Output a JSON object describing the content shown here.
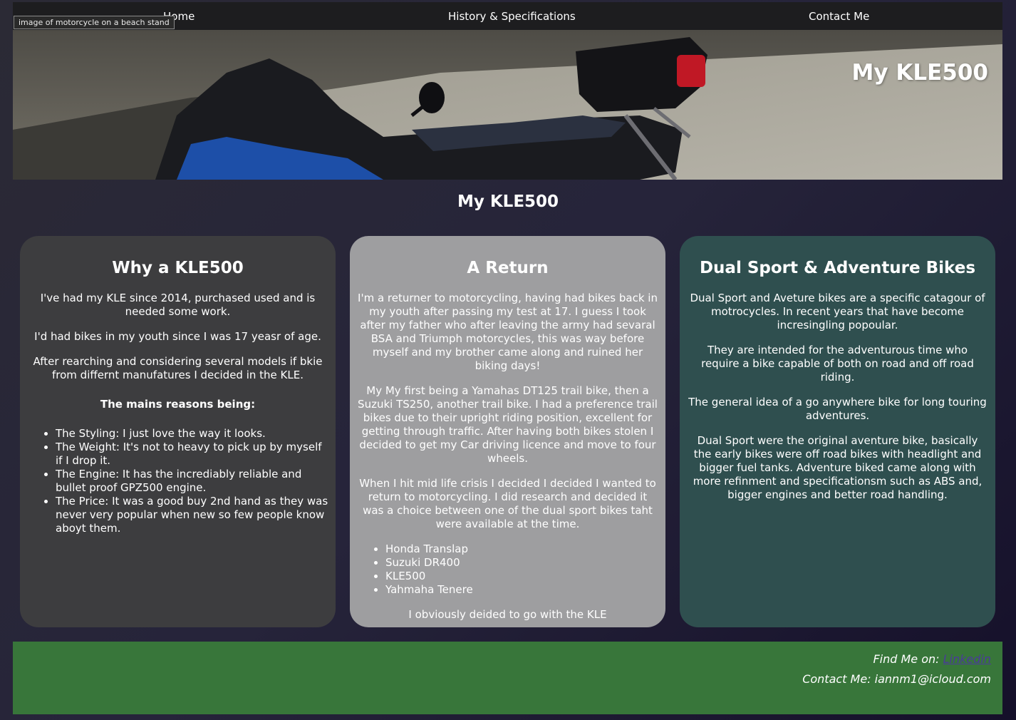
{
  "nav": {
    "home": "Home",
    "history": "History & Specifications",
    "contact": "Contact Me"
  },
  "hero": {
    "alt_tooltip": "image of motorcycle on a beach stand",
    "title": "My KLE500"
  },
  "page_title": "My KLE500",
  "cards": [
    {
      "title": "Why a KLE500",
      "paragraphs": [
        "I've had my KLE since 2014, purchased used and is needed some work.",
        "I'd had bikes in my youth since I was 17 yeasr of age.",
        "After rearching and considering several models if bkie from differnt manufatures I decided in the KLE."
      ],
      "reasons_heading": "The mains reasons being:",
      "reasons": [
        "The Styling: I just love the way it looks.",
        "The Weight: It's not to heavy to pick up by myself if I drop it.",
        "The Engine: It has the incrediably reliable and bullet proof GPZ500 engine.",
        "The Price: It was a good buy 2nd hand as they was never very popular when new so few people know aboyt them."
      ]
    },
    {
      "title": "A Return",
      "paragraphs": [
        "I'm a returner to motorcycling, having had bikes back in my youth after passing my test at 17. I guess I took after my father who after leaving the army had sevaral BSA and Triumph motorcycles, this was way before myself and my brother came along and ruined her biking days!",
        "My My first being a Yamahas DT125 trail bike, then a Suzuki TS250, another trail bike. I had a preference trail bikes due to their upright riding position, excellent for getting through traffic. After having both bikes stolen I decided to get my Car driving licence and move to four wheels.",
        "When I hit mid life crisis I decided I decided I wanted to return to motorcycling. I did research and decided it was a choice between one of the dual sport bikes taht were available at the time."
      ],
      "bikes": [
        "Honda Translap",
        "Suzuki DR400",
        "KLE500",
        "Yahmaha Tenere"
      ],
      "closing": "I obviously deided to go with the KLE"
    },
    {
      "title": "Dual Sport & Adventure Bikes",
      "paragraphs": [
        "Dual Sport and Aveture bikes are a specific catagour of motrocycles. In recent years that have become incresingling popoular.",
        "They are intended for the adventurous time who require a bike capable of both on road and off road riding.",
        "The general idea of a go anywhere bike for long touring adventures.",
        "Dual Sport were the original aventure bike, basically the early bikes were off road bikes with headlight and bigger fuel tanks. Adventure biked came along with more refinment and specificationsm such as ABS and, bigger engines and better road handling."
      ]
    }
  ],
  "footer": {
    "find_me_label": "Find Me on: ",
    "linkedin": "Linkedin",
    "contact": "Contact Me: iannm1@icloud.com"
  },
  "colors": {
    "nav_bg": "#1d1d1f",
    "card1_bg": "#3d3d3f",
    "card2_bg": "#9e9ea0",
    "card3_bg": "#2f4f4f",
    "footer_bg": "#38763a",
    "link": "#4a3a9a"
  }
}
